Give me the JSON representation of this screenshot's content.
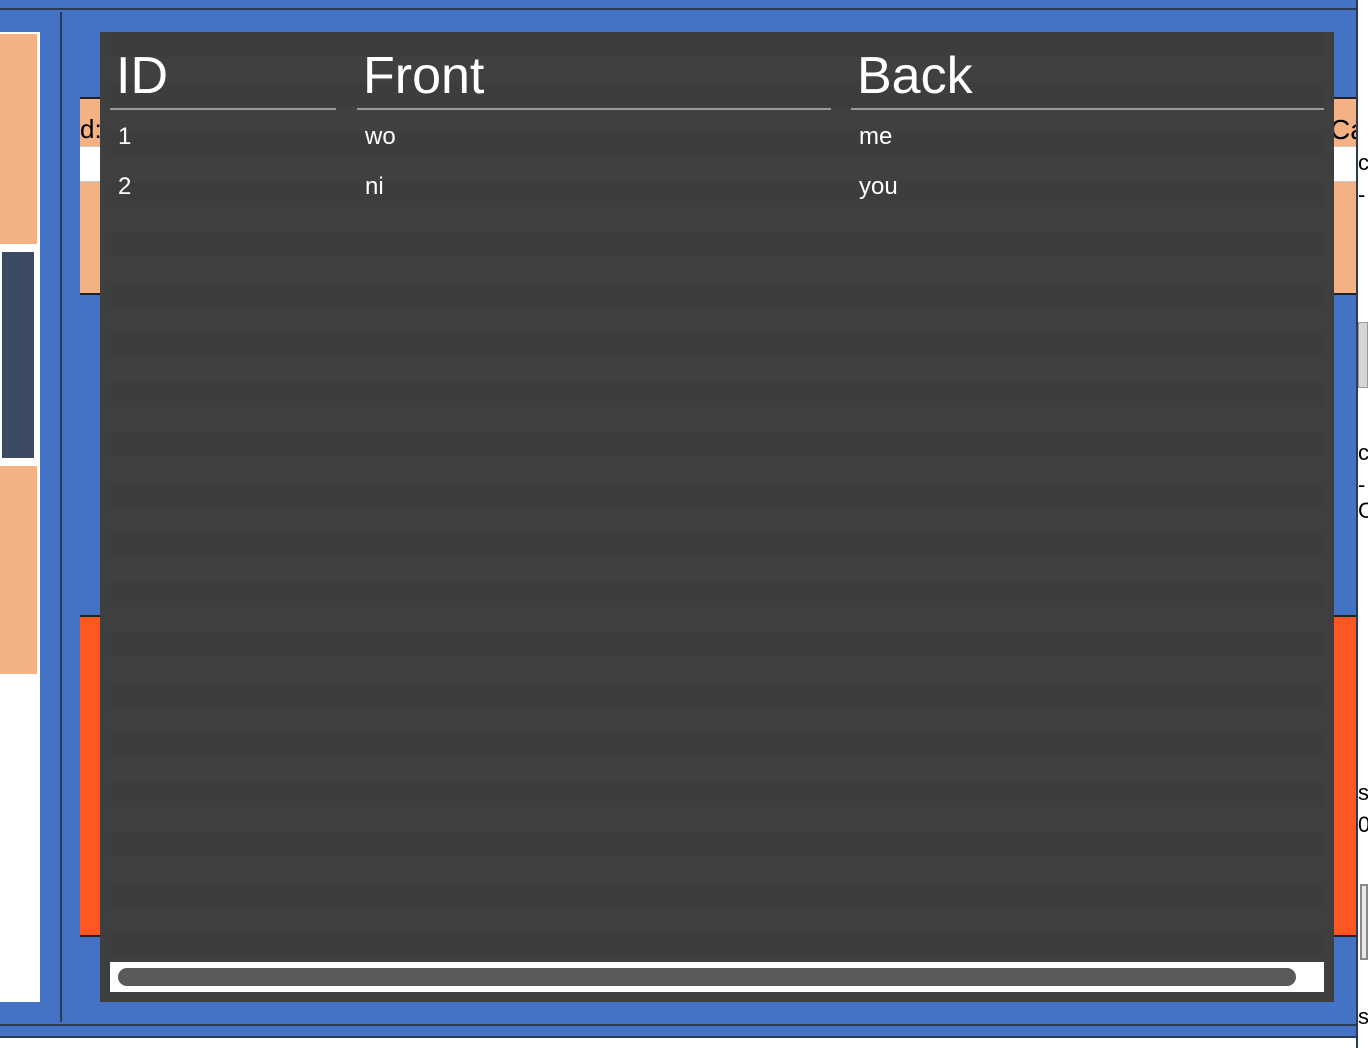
{
  "background": {
    "left_label_fragment": "d:",
    "right_label_fragment": "Ca",
    "right_edge_fragments": [
      "c",
      "-",
      "cr",
      "-C",
      "sc",
      "0",
      "sc"
    ]
  },
  "table": {
    "headers": {
      "id": "ID",
      "front": "Front",
      "back": "Back"
    },
    "rows": [
      {
        "id": "1",
        "front": "wo",
        "back": "me"
      },
      {
        "id": "2",
        "front": "ni",
        "back": "you"
      }
    ]
  },
  "colors": {
    "app_background": "#4472c4",
    "table_background": "#3f3f3f",
    "peach_panel": "#f4b183",
    "orange_panel": "#ff5722",
    "dark_tile": "#3c4a63"
  }
}
